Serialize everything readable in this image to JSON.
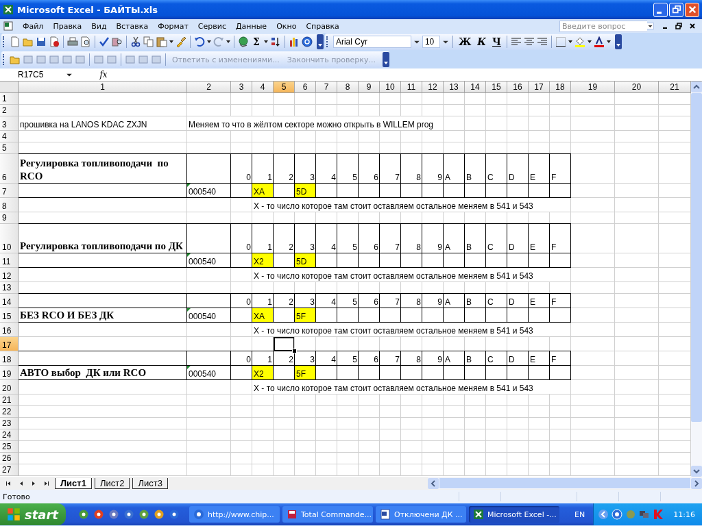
{
  "window": {
    "title": "Microsoft Excel - БАЙТЫ.xls"
  },
  "menu": [
    {
      "label": "Файл"
    },
    {
      "label": "Правка"
    },
    {
      "label": "Вид"
    },
    {
      "label": "Вставка"
    },
    {
      "label": "Формат"
    },
    {
      "label": "Сервис"
    },
    {
      "label": "Данные"
    },
    {
      "label": "Окно"
    },
    {
      "label": "Справка"
    }
  ],
  "help_box": {
    "placeholder": "Введите вопрос"
  },
  "standard_toolbar": {
    "sum_glyph": "Σ"
  },
  "formatting_toolbar": {
    "font": "Arial Cyr",
    "size": "10",
    "bold_glyph": "Ж",
    "italic_glyph": "К",
    "underline_glyph": "Ч"
  },
  "reviewing_toolbar": {
    "items": [
      {
        "label": "Ответить с изменениями...",
        "disabled": true
      },
      {
        "label": "Закончить проверку...",
        "disabled": true
      }
    ]
  },
  "formula_bar": {
    "name_box": "R17C5",
    "fx_label": "fx"
  },
  "sheet": {
    "columns": [
      {
        "label": "1",
        "selected": false
      },
      {
        "label": "2",
        "selected": false
      },
      {
        "label": "3",
        "selected": false
      },
      {
        "label": "4",
        "selected": false
      },
      {
        "label": "5",
        "selected": true
      },
      {
        "label": "6",
        "selected": false
      },
      {
        "label": "7",
        "selected": false
      },
      {
        "label": "8",
        "selected": false
      },
      {
        "label": "9",
        "selected": false
      },
      {
        "label": "10",
        "selected": false
      },
      {
        "label": "11",
        "selected": false
      },
      {
        "label": "12",
        "selected": false
      },
      {
        "label": "13",
        "selected": false
      },
      {
        "label": "14",
        "selected": false
      },
      {
        "label": "15",
        "selected": false
      },
      {
        "label": "16",
        "selected": false
      },
      {
        "label": "17",
        "selected": false
      },
      {
        "label": "18",
        "selected": false
      },
      {
        "label": "19",
        "selected": false
      },
      {
        "label": "20",
        "selected": false
      },
      {
        "label": "21",
        "selected": false
      }
    ],
    "rows": [
      {
        "header": "1",
        "selected": false,
        "bordered": false
      },
      {
        "header": "2",
        "selected": false,
        "bordered": false
      },
      {
        "header": "3",
        "selected": false,
        "bordered": false,
        "cells": [
          {
            "text": "прошивка на LANOS KDAC ZXJN",
            "kind": "text",
            "highlight": false
          },
          {
            "text": "Меняем то что в жёлтом секторе можно открыть в WILLEM prog",
            "kind": "text",
            "highlight": false
          }
        ]
      },
      {
        "header": "4",
        "selected": false,
        "bordered": false
      },
      {
        "header": "5",
        "selected": false,
        "bordered": false
      },
      {
        "header": "6",
        "selected": false,
        "bordered": true,
        "cells": [
          {
            "text": "Регулировка топливоподачи  по RCO",
            "kind": "title",
            "highlight": false
          },
          null,
          {
            "text": "0",
            "kind": "number",
            "highlight": false
          },
          {
            "text": "1",
            "kind": "number",
            "highlight": false
          },
          {
            "text": "2",
            "kind": "number",
            "highlight": false
          },
          {
            "text": "3",
            "kind": "number",
            "highlight": false
          },
          {
            "text": "4",
            "kind": "number",
            "highlight": false
          },
          {
            "text": "5",
            "kind": "number",
            "highlight": false
          },
          {
            "text": "6",
            "kind": "number",
            "highlight": false
          },
          {
            "text": "7",
            "kind": "number",
            "highlight": false
          },
          {
            "text": "8",
            "kind": "number",
            "highlight": false
          },
          {
            "text": "9",
            "kind": "number",
            "highlight": false
          },
          {
            "text": "A",
            "kind": "text",
            "highlight": false
          },
          {
            "text": "B",
            "kind": "text",
            "highlight": false
          },
          {
            "text": "C",
            "kind": "text",
            "highlight": false
          },
          {
            "text": "D",
            "kind": "text",
            "highlight": false
          },
          {
            "text": "E",
            "kind": "text",
            "highlight": false
          },
          {
            "text": "F",
            "kind": "text",
            "highlight": false
          }
        ]
      },
      {
        "header": "7",
        "selected": false,
        "bordered": true,
        "cells": [
          null,
          {
            "text": "000540",
            "kind": "code",
            "highlight": false
          },
          null,
          {
            "text": "XA",
            "kind": "text",
            "highlight": true
          },
          null,
          {
            "text": "5D",
            "kind": "text",
            "highlight": true
          }
        ]
      },
      {
        "header": "8",
        "selected": false,
        "bordered": false,
        "cells": [
          null,
          null,
          null,
          {
            "text": "X - то число которое там стоит оставляем остальное меняем в 541 и 543",
            "kind": "text",
            "highlight": false
          }
        ]
      },
      {
        "header": "9",
        "selected": false,
        "bordered": false
      },
      {
        "header": "10",
        "selected": false,
        "bordered": true,
        "cells": [
          {
            "text": "Регулировка топливоподачи по ДК",
            "kind": "title",
            "highlight": false
          },
          null,
          {
            "text": "0",
            "kind": "number",
            "highlight": false
          },
          {
            "text": "1",
            "kind": "number",
            "highlight": false
          },
          {
            "text": "2",
            "kind": "number",
            "highlight": false
          },
          {
            "text": "3",
            "kind": "number",
            "highlight": false
          },
          {
            "text": "4",
            "kind": "number",
            "highlight": false
          },
          {
            "text": "5",
            "kind": "number",
            "highlight": false
          },
          {
            "text": "6",
            "kind": "number",
            "highlight": false
          },
          {
            "text": "7",
            "kind": "number",
            "highlight": false
          },
          {
            "text": "8",
            "kind": "number",
            "highlight": false
          },
          {
            "text": "9",
            "kind": "number",
            "highlight": false
          },
          {
            "text": "A",
            "kind": "text",
            "highlight": false
          },
          {
            "text": "B",
            "kind": "text",
            "highlight": false
          },
          {
            "text": "C",
            "kind": "text",
            "highlight": false
          },
          {
            "text": "D",
            "kind": "text",
            "highlight": false
          },
          {
            "text": "E",
            "kind": "text",
            "highlight": false
          },
          {
            "text": "F",
            "kind": "text",
            "highlight": false
          }
        ]
      },
      {
        "header": "11",
        "selected": false,
        "bordered": true,
        "cells": [
          null,
          {
            "text": "000540",
            "kind": "code",
            "highlight": false
          },
          null,
          {
            "text": "X2",
            "kind": "text",
            "highlight": true
          },
          null,
          {
            "text": "5D",
            "kind": "text",
            "highlight": true
          }
        ]
      },
      {
        "header": "12",
        "selected": false,
        "bordered": false,
        "cells": [
          null,
          null,
          null,
          {
            "text": "X - то число которое там стоит оставляем остальное меняем в 541 и 543",
            "kind": "text",
            "highlight": false
          }
        ]
      },
      {
        "header": "13",
        "selected": false,
        "bordered": false
      },
      {
        "header": "14",
        "selected": false,
        "bordered": true,
        "cells": [
          null,
          null,
          {
            "text": "0",
            "kind": "number",
            "highlight": false
          },
          {
            "text": "1",
            "kind": "number",
            "highlight": false
          },
          {
            "text": "2",
            "kind": "number",
            "highlight": false
          },
          {
            "text": "3",
            "kind": "number",
            "highlight": false
          },
          {
            "text": "4",
            "kind": "number",
            "highlight": false
          },
          {
            "text": "5",
            "kind": "number",
            "highlight": false
          },
          {
            "text": "6",
            "kind": "number",
            "highlight": false
          },
          {
            "text": "7",
            "kind": "number",
            "highlight": false
          },
          {
            "text": "8",
            "kind": "number",
            "highlight": false
          },
          {
            "text": "9",
            "kind": "number",
            "highlight": false
          },
          {
            "text": "A",
            "kind": "text",
            "highlight": false
          },
          {
            "text": "B",
            "kind": "text",
            "highlight": false
          },
          {
            "text": "C",
            "kind": "text",
            "highlight": false
          },
          {
            "text": "D",
            "kind": "text",
            "highlight": false
          },
          {
            "text": "E",
            "kind": "text",
            "highlight": false
          },
          {
            "text": "F",
            "kind": "text",
            "highlight": false
          }
        ]
      },
      {
        "header": "15",
        "selected": false,
        "bordered": true,
        "cells": [
          {
            "text": "БЕЗ RCO И БЕЗ ДК",
            "kind": "title",
            "highlight": false
          },
          {
            "text": "000540",
            "kind": "code",
            "highlight": false
          },
          null,
          {
            "text": "XA",
            "kind": "text",
            "highlight": true
          },
          null,
          {
            "text": "5F",
            "kind": "text",
            "highlight": true
          }
        ]
      },
      {
        "header": "16",
        "selected": false,
        "bordered": false,
        "cells": [
          null,
          null,
          null,
          {
            "text": "X - то число которое там стоит оставляем остальное меняем в 541 и 543",
            "kind": "text",
            "highlight": false
          }
        ]
      },
      {
        "header": "17",
        "selected": true,
        "bordered": false
      },
      {
        "header": "18",
        "selected": false,
        "bordered": true,
        "cells": [
          null,
          null,
          {
            "text": "0",
            "kind": "number",
            "highlight": false
          },
          {
            "text": "1",
            "kind": "number",
            "highlight": false
          },
          {
            "text": "2",
            "kind": "number",
            "highlight": false
          },
          {
            "text": "3",
            "kind": "number",
            "highlight": false
          },
          {
            "text": "4",
            "kind": "number",
            "highlight": false
          },
          {
            "text": "5",
            "kind": "number",
            "highlight": false
          },
          {
            "text": "6",
            "kind": "number",
            "highlight": false
          },
          {
            "text": "7",
            "kind": "number",
            "highlight": false
          },
          {
            "text": "8",
            "kind": "number",
            "highlight": false
          },
          {
            "text": "9",
            "kind": "number",
            "highlight": false
          },
          {
            "text": "A",
            "kind": "text",
            "highlight": false
          },
          {
            "text": "B",
            "kind": "text",
            "highlight": false
          },
          {
            "text": "C",
            "kind": "text",
            "highlight": false
          },
          {
            "text": "D",
            "kind": "text",
            "highlight": false
          },
          {
            "text": "E",
            "kind": "text",
            "highlight": false
          },
          {
            "text": "F",
            "kind": "text",
            "highlight": false
          }
        ]
      },
      {
        "header": "19",
        "selected": false,
        "bordered": true,
        "cells": [
          {
            "text": "АВТО выбор  ДК или RCO",
            "kind": "title",
            "highlight": false
          },
          {
            "text": "000540",
            "kind": "code",
            "highlight": false
          },
          null,
          {
            "text": "X2",
            "kind": "text",
            "highlight": true
          },
          null,
          {
            "text": "5F",
            "kind": "text",
            "highlight": true
          }
        ]
      },
      {
        "header": "20",
        "selected": false,
        "bordered": false,
        "cells": [
          null,
          null,
          null,
          {
            "text": "X - то число которое там стоит оставляем остальное меняем в 541 и 543",
            "kind": "text",
            "highlight": false
          }
        ]
      },
      {
        "header": "21",
        "selected": false,
        "bordered": false
      },
      {
        "header": "22",
        "selected": false,
        "bordered": false
      },
      {
        "header": "23",
        "selected": false,
        "bordered": false
      },
      {
        "header": "24",
        "selected": false,
        "bordered": false
      },
      {
        "header": "25",
        "selected": false,
        "bordered": false
      },
      {
        "header": "26",
        "selected": false,
        "bordered": false
      },
      {
        "header": "27",
        "selected": false,
        "bordered": false
      }
    ]
  },
  "sheet_tabs": [
    {
      "label": "Лист1",
      "selected": true
    },
    {
      "label": "Лист2",
      "selected": false
    },
    {
      "label": "Лист3",
      "selected": false
    }
  ],
  "status_bar": {
    "text": "Готово"
  },
  "taskbar": {
    "start_label": "start",
    "tasks": [
      {
        "label": "http://www.chip...",
        "kind": "browser",
        "selected": false
      },
      {
        "label": "Total Commande...",
        "kind": "file-manager",
        "selected": false
      },
      {
        "label": "Отключени ДК ...",
        "kind": "document",
        "selected": false
      },
      {
        "label": "Microsoft Excel -...",
        "kind": "spreadsheet",
        "selected": true
      }
    ],
    "language": "EN",
    "clock": "11:16"
  }
}
